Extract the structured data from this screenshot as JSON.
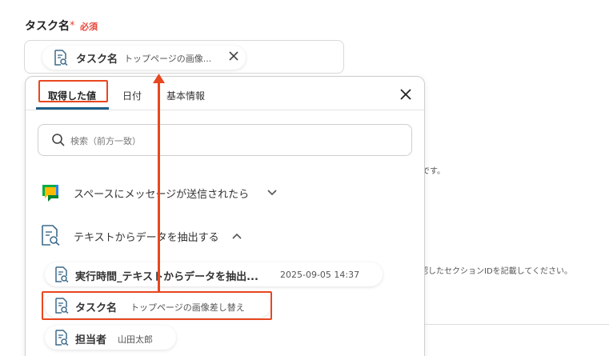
{
  "field": {
    "label": "タスク名",
    "required_mark": "*",
    "required_text": "必須",
    "chip": {
      "name": "タスク名",
      "value": "トップページの画像...",
      "icon": "document-search-icon"
    }
  },
  "background": {
    "text_1": "です。",
    "text_2": "認したセクションIDを記載してください。"
  },
  "dropdown": {
    "tabs": [
      "取得した値",
      "日付",
      "基本情報"
    ],
    "active_tab": "取得した値",
    "search": {
      "placeholder": "検索（前方一致）"
    },
    "groups": [
      {
        "label": "スペースにメッセージが送信されたら",
        "icon": "google-chat-icon",
        "expanded": false
      },
      {
        "label": "テキストからデータを抽出する",
        "icon": "document-search-icon",
        "expanded": true
      }
    ],
    "items": [
      {
        "name": "実行時間_テキストからデータを抽出...",
        "value": "2025-09-05 14:37"
      },
      {
        "name": "タスク名",
        "value": "トップページの画像差し替え"
      },
      {
        "name": "担当者",
        "value": "山田太郎"
      }
    ]
  },
  "colors": {
    "accent": "#e8471f",
    "required": "#e8473a",
    "tab_underline": "#1f5f8a",
    "chat_green": "#00ac47",
    "chat_yellow": "#ffba00",
    "chat_blue": "#2684fc"
  }
}
